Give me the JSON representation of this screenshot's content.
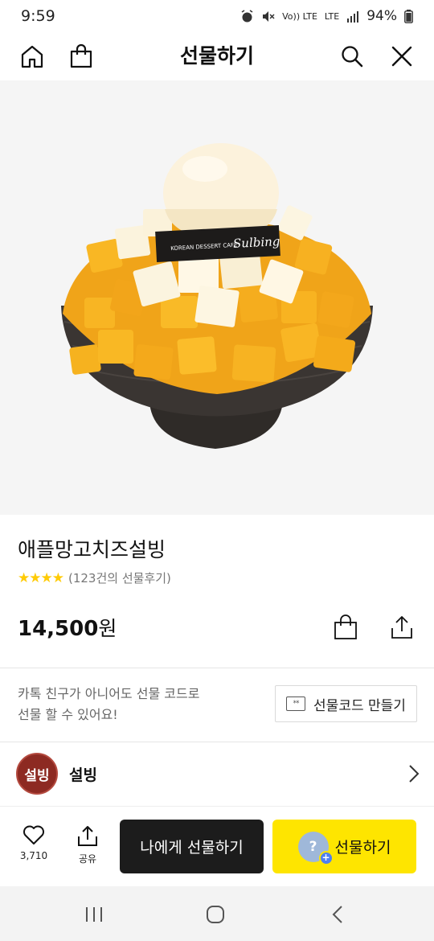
{
  "status_bar": {
    "time": "9:59",
    "indicators": [
      "alarm-icon",
      "mute-icon",
      "volte-icon",
      "lte-icon",
      "signal-icon"
    ],
    "volte_text": "Vo)) LTE",
    "lte_text": "LTE",
    "battery_percent": "94%"
  },
  "header": {
    "title": "선물하기",
    "left_icons": [
      "home-icon",
      "bag-icon"
    ],
    "right_icons": [
      "search-icon",
      "close-icon"
    ]
  },
  "hero": {
    "image_label": "KOREAN DESSERT CAFE",
    "image_brand": "Sulbing",
    "background": "#f5f5f5"
  },
  "product": {
    "name": "애플망고치즈설빙",
    "stars": "★★★★",
    "review_text": "(123건의 선물후기)",
    "price": "14,500",
    "price_unit": "원"
  },
  "gift_code": {
    "line1": "카톡 친구가 아니어도 선물 코드로",
    "line2": "선물 할 수 있어요!",
    "button_icon_text": "**",
    "button_label": "선물코드 만들기"
  },
  "brand": {
    "logo_text": "설빙",
    "name": "설빙"
  },
  "bottom_bar": {
    "like_count": "3,710",
    "share_label": "공유",
    "gift_me_label": "나에게 선물하기",
    "gift_label": "선물하기",
    "gift_avatar_text": "?",
    "gift_plus": "+"
  },
  "colors": {
    "accent_yellow": "#fee500",
    "star_yellow": "#ffcb05",
    "dark_button": "#1c1c1c",
    "brand_red": "#8d2a22"
  }
}
